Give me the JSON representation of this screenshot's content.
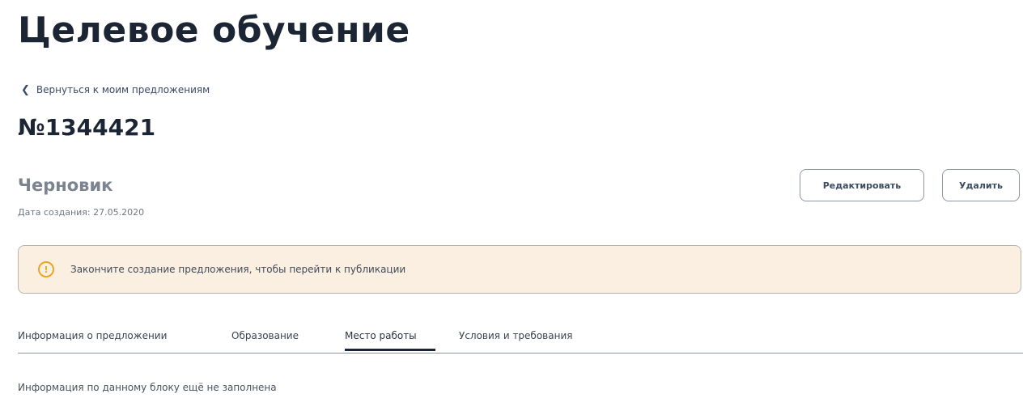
{
  "page": {
    "title": "Целевое обучение"
  },
  "nav": {
    "back_icon": "chevron-left-icon",
    "back_label": "Вернуться к моим предложениям"
  },
  "offer": {
    "number": "№1344421",
    "status": "Черновик",
    "created": "Дата создания: 27.05.2020"
  },
  "actions": {
    "edit_label": "Редактировать",
    "delete_label": "Удалить"
  },
  "notice": {
    "icon": "warning-circle-icon",
    "icon_glyph": "!",
    "text": "Закончите создание предложения, чтобы перейти к публикации",
    "background": "#fbefe2",
    "icon_color": "#e8a624"
  },
  "tabs": [
    {
      "label": "Информация о предложении",
      "active": false
    },
    {
      "label": "Образование",
      "active": false
    },
    {
      "label": "Место работы",
      "active": true
    },
    {
      "label": "Условия и требования",
      "active": false
    }
  ],
  "content": {
    "empty_message": "Информация по данному блоку ещё не заполнена"
  }
}
